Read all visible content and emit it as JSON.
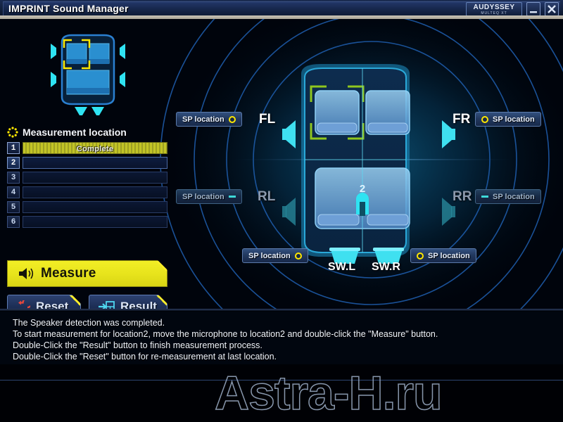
{
  "window": {
    "title": "IMPRINT Sound Manager",
    "brand_line1": "AUDYSSEY",
    "brand_line2": "MULTEQ XT",
    "minimize_label": "Minimize",
    "close_label": "Close"
  },
  "measurement": {
    "header": "Measurement location",
    "header_icon": "gear-icon",
    "rows": [
      {
        "num": "1",
        "status": "Complete",
        "state": "complete"
      },
      {
        "num": "2",
        "status": "",
        "state": "active"
      },
      {
        "num": "3",
        "status": "",
        "state": "empty"
      },
      {
        "num": "4",
        "status": "",
        "state": "empty"
      },
      {
        "num": "5",
        "status": "",
        "state": "empty"
      },
      {
        "num": "6",
        "status": "",
        "state": "empty"
      }
    ]
  },
  "buttons": {
    "measure": "Measure",
    "reset": "Reset",
    "result": "Result"
  },
  "speakers": {
    "sp_location_label": "SP location",
    "fl": {
      "name": "FL",
      "active": true
    },
    "fr": {
      "name": "FR",
      "active": true
    },
    "rl": {
      "name": "RL",
      "active": false
    },
    "rr": {
      "name": "RR",
      "active": false
    },
    "swl": {
      "name": "SW.L",
      "active": true
    },
    "swr": {
      "name": "SW.R",
      "active": true
    }
  },
  "car": {
    "seat_marker": "2"
  },
  "status": {
    "line1": "The Speaker detection was completed.",
    "line2": "To start measurement for location2, move the microphone to location2 and double-click the \"Measure\" button.",
    "line3": "Double-Click the \"Result\" button to finish measurement process.",
    "line4": "Double-Click the \"Reset\" button for re-measurement at last location."
  },
  "watermark": {
    "text": "Astra-H.ru"
  },
  "colors": {
    "accent_yellow": "#ffe800",
    "accent_cyan": "#3fd8d8",
    "panel_blue": "#22395f",
    "complete_bar": "#c2c426",
    "highlight_green": "#8fc61e"
  }
}
